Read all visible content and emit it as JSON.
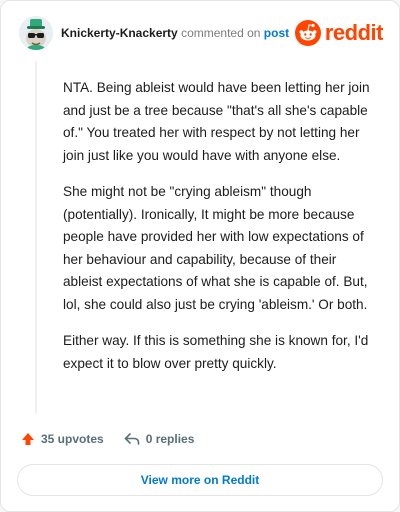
{
  "header": {
    "author": "Knickerty-Knackerty",
    "action_text": "commented on",
    "post_link": "post",
    "brand": "reddit"
  },
  "comment": {
    "paragraphs": [
      "NTA. Being ableist would have been letting her join and just be a tree because \"that's all she's capable of.\" You treated her with respect by not letting her join just like you would have with anyone else.",
      "She might not be \"crying ableism\" though (potentially). Ironically, It might be more because people have provided her with low expectations of her behaviour and capability, because of their ableist expectations of what she is capable of. But, lol, she could also just be crying 'ableism.' Or both.",
      "Either way. If this is something she is known for, I'd expect it to blow over pretty quickly."
    ]
  },
  "actions": {
    "upvotes": "35 upvotes",
    "replies": "0 replies"
  },
  "footer": {
    "button_label": "View more on Reddit"
  },
  "colors": {
    "brand": "#ff4500",
    "link": "#0079d3",
    "upvote": "#ff4500"
  },
  "icons": [
    "avatar-mascot-icon",
    "reddit-logo-icon",
    "upvote-arrow-icon",
    "reply-arrow-icon"
  ]
}
